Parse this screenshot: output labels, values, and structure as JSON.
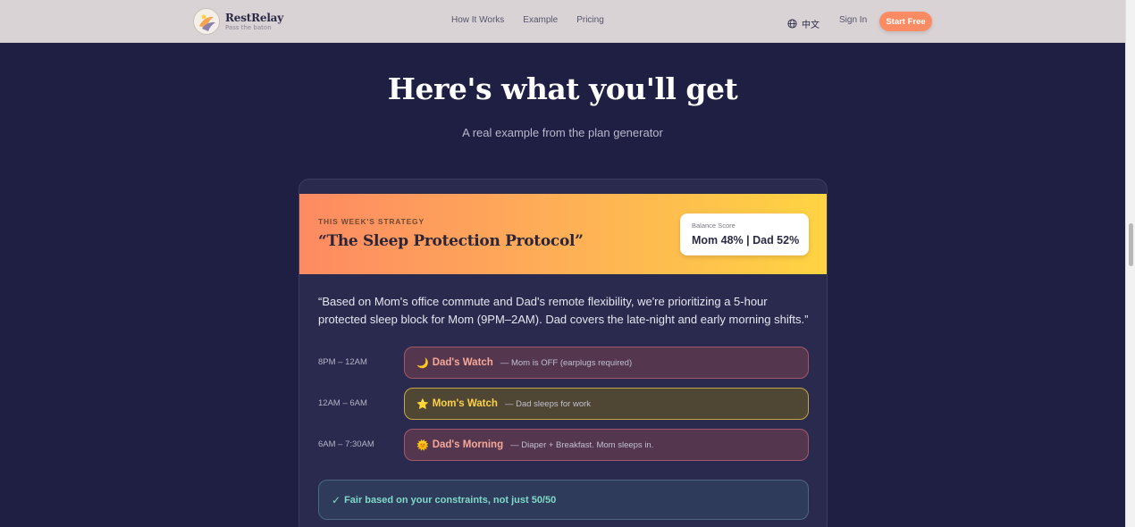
{
  "brand": {
    "name": "RestRelay",
    "tagline": "Pass the baton"
  },
  "nav": {
    "links": [
      "How It Works",
      "Example",
      "Pricing"
    ],
    "language": "中文",
    "sign_in": "Sign In",
    "start_free": "Start Free"
  },
  "hero": {
    "title": "Here's what you'll get",
    "subtitle": "A real example from the plan generator"
  },
  "strategy": {
    "label": "THIS WEEK'S STRATEGY",
    "title": "“The Sleep Protection Protocol”",
    "score_label": "Balance Score",
    "score_value": "Mom 48% | Dad 52%"
  },
  "quote": "“Based on Mom's office commute and Dad's remote flexibility, we're prioritizing a 5-hour protected sleep block for Mom (9PM–2AM). Dad covers the late-night and early morning shifts.”",
  "schedule": [
    {
      "time": "8PM – 12AM",
      "icon": "🌙",
      "icon_name": "moon-icon",
      "title": "Dad's Watch",
      "desc": "— Mom is OFF (earplugs required)"
    },
    {
      "time": "12AM – 6AM",
      "icon": "⭐",
      "icon_name": "star-icon",
      "title": "Mom's Watch",
      "desc": "— Dad sleeps for work"
    },
    {
      "time": "6AM – 7:30AM",
      "icon": "🌞",
      "icon_name": "sun-icon",
      "title": "Dad's Morning",
      "desc": "— Diaper + Breakfast. Mom sleeps in."
    }
  ],
  "fairness": {
    "check": "✓",
    "text": "Fair based on your constraints, not just 50/50"
  },
  "colors": {
    "background": "#1f1f44",
    "accent": "#fb8b63",
    "gradient_start": "#fe8a62",
    "gradient_end": "#ffd442"
  }
}
